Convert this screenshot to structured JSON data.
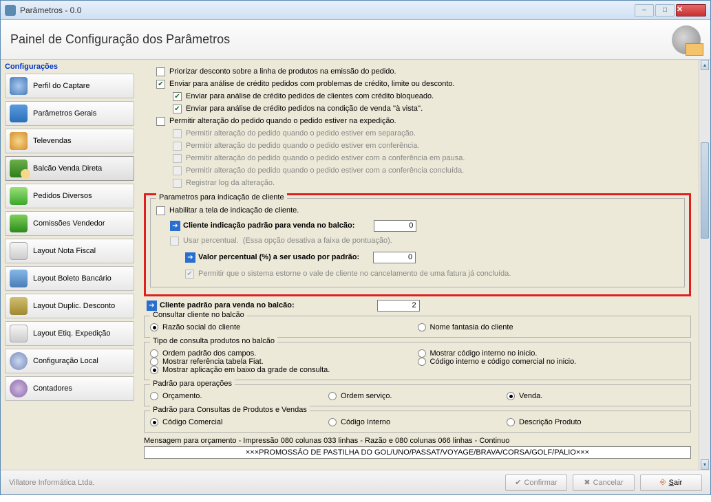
{
  "window": {
    "title": "Parâmetros - 0.0"
  },
  "panel": {
    "title": "Painel de Configuração dos Parâmetros"
  },
  "sidebar": {
    "title": "Configurações",
    "items": [
      {
        "label": "Perfil do Captare"
      },
      {
        "label": "Parâmetros Gerais"
      },
      {
        "label": "Televendas"
      },
      {
        "label": "Balcão Venda Direta"
      },
      {
        "label": "Pedidos Diversos"
      },
      {
        "label": "Comissões Vendedor"
      },
      {
        "label": "Layout Nota Fiscal"
      },
      {
        "label": "Layout Boleto Bancário"
      },
      {
        "label": "Layout Duplic. Desconto"
      },
      {
        "label": "Layout Etiq. Expedição"
      },
      {
        "label": "Configuração Local"
      },
      {
        "label": "Contadores"
      }
    ]
  },
  "checks": {
    "c1": "Priorizar desconto sobre a linha de produtos na emissão do pedido.",
    "c2": "Enviar para análise de crédito pedidos com problemas de crédito, limite ou desconto.",
    "c2a": "Enviar para análise de crédito pedidos de clientes com crédito bloqueado.",
    "c2b": "Enviar para análise de crédito pedidos na condição de venda ''à vista''.",
    "c3": "Permitir alteração do pedido quando o pedido estiver na expedição.",
    "c3a": "Permitir alteração do pedido quando o pedido estiver em separação.",
    "c3b": "Permitir alteração do pedido quando o pedido estiver em conferência.",
    "c3c": "Permitir alteração do pedido quando o pedido estiver com a conferência em pausa.",
    "c3d": "Permitir alteração do pedido quando o pedido estiver com a conferência concluída.",
    "c3e": "Registrar log da alteração."
  },
  "redgroup": {
    "title": "Parametros para indicação de cliente",
    "chk": "Habilitar a tela de indicação de cliente.",
    "l1": "Cliente indicação padrão para venda no balcão:",
    "v1": "0",
    "chk2": "Usar percentual.",
    "note2": "(Essa opção desativa a faixa de pontuação).",
    "l2": "Valor percentual (%) a ser usado por padrão:",
    "v2": "0",
    "chk3": "Permitir que o sistema estorne o vale de cliente no cancelamento de uma fatura já concluída."
  },
  "cliente_padrao": {
    "label": "Cliente padrão para venda no balcão:",
    "value": "2"
  },
  "g_consultar": {
    "title": "Consultar cliente no balcão",
    "r1": "Razão social do cliente",
    "r2": "Nome fantasia do cliente"
  },
  "g_tipo": {
    "title": "Tipo de consulta produtos no balcão",
    "r1": "Ordem padrão dos campos.",
    "r2": "Mostrar código interno no inicio.",
    "r3": "Mostrar referência tabela Fiat.",
    "r4": "Código interno e código comercial no inicio.",
    "chk": "Mostrar aplicação em baixo da grade de consulta."
  },
  "g_oper": {
    "title": "Padrão para operações",
    "r1": "Orçamento.",
    "r2": "Ordem serviço.",
    "r3": "Venda."
  },
  "g_cons": {
    "title": "Padrão para Consultas de Produtos e Vendas",
    "r1": "Código Comercial",
    "r2": "Código Interno",
    "r3": "Descrição Produto"
  },
  "msg": {
    "label": "Mensagem para orçamento - Impressão 080 colunas 033 linhas - Razão e 080 colunas 066 linhas - Continuo",
    "value": "×××PROMOSSÃO DE PASTILHA DO GOL/UNO/PASSAT/VOYAGE/BRAVA/CORSA/GOLF/PALIO×××"
  },
  "footer": {
    "brand": "Villatore Informática Ltda.",
    "confirm": "Confirmar",
    "cancel": "Cancelar",
    "exit": "Sair"
  }
}
